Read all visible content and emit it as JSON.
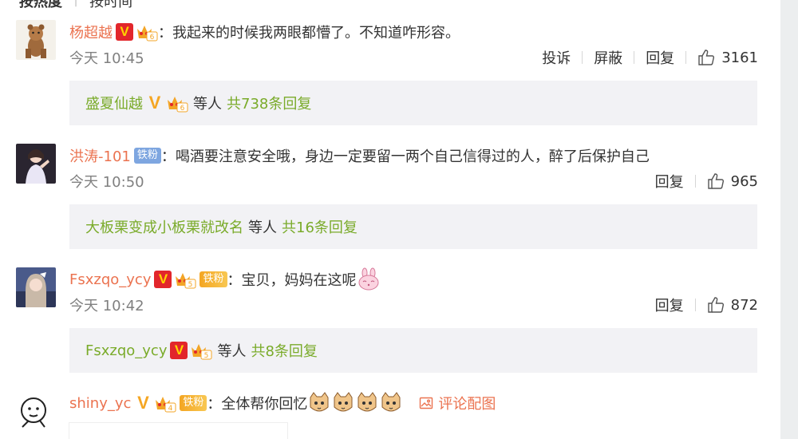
{
  "sort_tabs": {
    "active": "按热度",
    "inactive": "按时间"
  },
  "comments": [
    {
      "user": "杨超越",
      "verify": "V",
      "level": "6",
      "text": "我起来的时候我两眼都懵了。不知道咋形容。",
      "time": "今天 10:45",
      "actions": [
        "投诉",
        "屏蔽",
        "回复"
      ],
      "likes": "3161",
      "reply_summary": {
        "name": "盛夏仙越",
        "verify": "V",
        "level": "6",
        "mid": "等人",
        "count": "共738条回复"
      }
    },
    {
      "user": "洪涛-101",
      "fan_badge": "铁粉",
      "text": "喝酒要注意安全哦，身边一定要留一两个自己信得过的人，醉了后保护自己",
      "time": "今天 10:50",
      "actions": [
        "回复"
      ],
      "likes": "965",
      "reply_summary": {
        "name": "大板栗变成小板栗就改名",
        "mid": "等人",
        "count": "共16条回复"
      }
    },
    {
      "user": "Fsxzqo_ycy",
      "verify": "V",
      "level": "5",
      "fan_badge": "铁粉",
      "text": "宝贝，妈妈在这呢",
      "time": "今天 10:42",
      "actions": [
        "回复"
      ],
      "likes": "872",
      "reply_summary": {
        "name": "Fsxzqo_ycy",
        "verify": "V",
        "level": "5",
        "mid": "等人",
        "count": "共8条回复"
      }
    },
    {
      "user": "shiny_yc",
      "verify": "V",
      "level": "4",
      "fan_badge": "铁粉",
      "text": "全体帮你回忆",
      "pic_link": "评论配图"
    }
  ],
  "colors": {
    "username": "#eb7350",
    "reply_name": "#7aab2a",
    "time": "#808080",
    "reply_bg": "#f2f2f5"
  }
}
